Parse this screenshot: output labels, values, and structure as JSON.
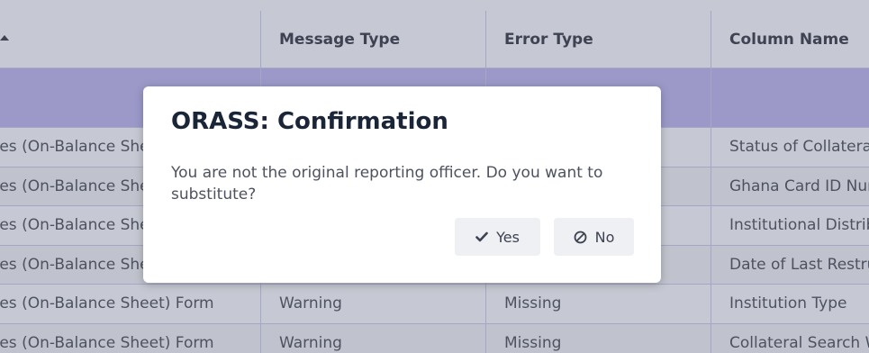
{
  "table": {
    "columns": [
      {
        "label": ""
      },
      {
        "label": "Message Type"
      },
      {
        "label": "Error Type"
      },
      {
        "label": "Column Name"
      }
    ],
    "rows": [
      [
        "ces (On-Balance Sheet) Form",
        "",
        "",
        "Status of Collateral"
      ],
      [
        "ces (On-Balance Sheet) Form",
        "",
        "",
        "Ghana Card ID Number"
      ],
      [
        "ces (On-Balance Sheet) Form",
        "",
        "",
        "Institutional Distribution"
      ],
      [
        "ces (On-Balance Sheet) Form",
        "",
        "",
        "Date of Last Restructure"
      ],
      [
        "ces (On-Balance Sheet) Form",
        "Warning",
        "Missing",
        "Institution Type"
      ],
      [
        "ces (On-Balance Sheet) Form",
        "Warning",
        "Missing",
        "Collateral Search W"
      ]
    ]
  },
  "dialog": {
    "title": "ORASS: Confirmation",
    "message": "You are not the original reporting officer. Do you want to substitute?",
    "yes_label": "Yes",
    "no_label": "No"
  }
}
